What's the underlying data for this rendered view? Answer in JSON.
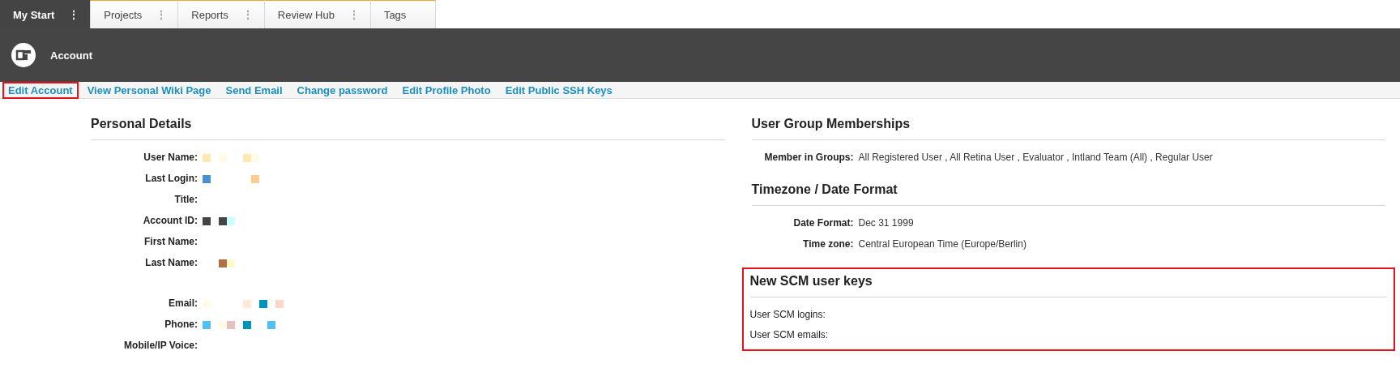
{
  "tabs": [
    {
      "label": "My Start",
      "menu": "⋮",
      "selected": true
    },
    {
      "label": "Projects",
      "menu": "⋮",
      "selected": false
    },
    {
      "label": "Reports",
      "menu": "⋮",
      "selected": false
    },
    {
      "label": "Review Hub",
      "menu": "⋮",
      "selected": false
    },
    {
      "label": "Tags",
      "selected": false
    }
  ],
  "header": {
    "title": "Account"
  },
  "actions": [
    {
      "label": "Edit Account",
      "highlighted": true
    },
    {
      "label": "View Personal Wiki Page",
      "highlighted": false
    },
    {
      "label": "Send Email",
      "highlighted": false
    },
    {
      "label": "Change password",
      "highlighted": false
    },
    {
      "label": "Edit Profile Photo",
      "highlighted": false
    },
    {
      "label": "Edit Public SSH Keys",
      "highlighted": false
    }
  ],
  "personal_details": {
    "title": "Personal Details",
    "fields": [
      {
        "label": "User Name:",
        "pixels": [
          {
            "color": "#ffe8b3"
          },
          {
            "color": "#ffffff"
          },
          {
            "color": "#fffbe6"
          },
          {
            "color": "#ffffff"
          },
          {
            "color": "#ffffff"
          },
          {
            "color": "#ffe8b3"
          },
          {
            "color": "#fffbe6"
          }
        ]
      },
      {
        "label": "Last Login:",
        "pixels": [
          {
            "color": "#4a90d0"
          },
          {
            "color": "#ffffff"
          },
          {
            "color": "#ffffff"
          },
          {
            "color": "#ffffff"
          },
          {
            "color": "#ffffff"
          },
          {
            "color": "#ffffff"
          },
          {
            "color": "#ffcc90"
          }
        ]
      },
      {
        "label": "Title:"
      },
      {
        "label": "Account ID:",
        "pixels": [
          {
            "color": "#444444"
          },
          {
            "color": "#ffffff"
          },
          {
            "color": "#444444"
          },
          {
            "color": "#ccffff"
          }
        ]
      },
      {
        "label": "First Name:"
      },
      {
        "label": "Last Name:",
        "indented": true,
        "pixels": [
          {
            "color": "#b07048"
          },
          {
            "color": "#fff8cc"
          }
        ]
      },
      {
        "label": "Email:",
        "spaced_above": true,
        "pixels": [
          {
            "color": "#fffbe6"
          },
          {
            "color": "#ffffff"
          },
          {
            "color": "#ffffff"
          },
          {
            "color": "#ffffff"
          },
          {
            "color": "#ffffff"
          },
          {
            "color": "#ffe8d6"
          },
          {
            "color": "#ffffff"
          },
          {
            "color": "#0092b8"
          },
          {
            "color": "#ffffff"
          },
          {
            "color": "#ffd6cc"
          }
        ]
      },
      {
        "label": "Phone:",
        "pixels": [
          {
            "color": "#55c0f0"
          },
          {
            "color": "#ffffff"
          },
          {
            "color": "#fffbe6"
          },
          {
            "color": "#e8c0c0"
          },
          {
            "color": "#ffffff"
          },
          {
            "color": "#0092b8"
          },
          {
            "color": "#ffffff"
          },
          {
            "color": "#ffffff"
          },
          {
            "color": "#55c0f0"
          }
        ]
      },
      {
        "label": "Mobile/IP Voice:"
      }
    ]
  },
  "group_memberships": {
    "title": "User Group Memberships",
    "fields": [
      {
        "label": "Member in Groups:",
        "value": "All Registered User , All Retina User , Evaluator , Intland Team (All) , Regular User"
      }
    ]
  },
  "timezone": {
    "title": "Timezone / Date Format",
    "fields": [
      {
        "label": "Date Format:",
        "value": "Dec 31 1999"
      },
      {
        "label": "Time zone:",
        "value": "Central European Time (Europe/Berlin)"
      }
    ]
  },
  "scm_keys": {
    "title": "New SCM user keys",
    "highlighted": true,
    "fields": [
      {
        "label": "User SCM logins:"
      },
      {
        "label": "User SCM emails:"
      }
    ]
  }
}
